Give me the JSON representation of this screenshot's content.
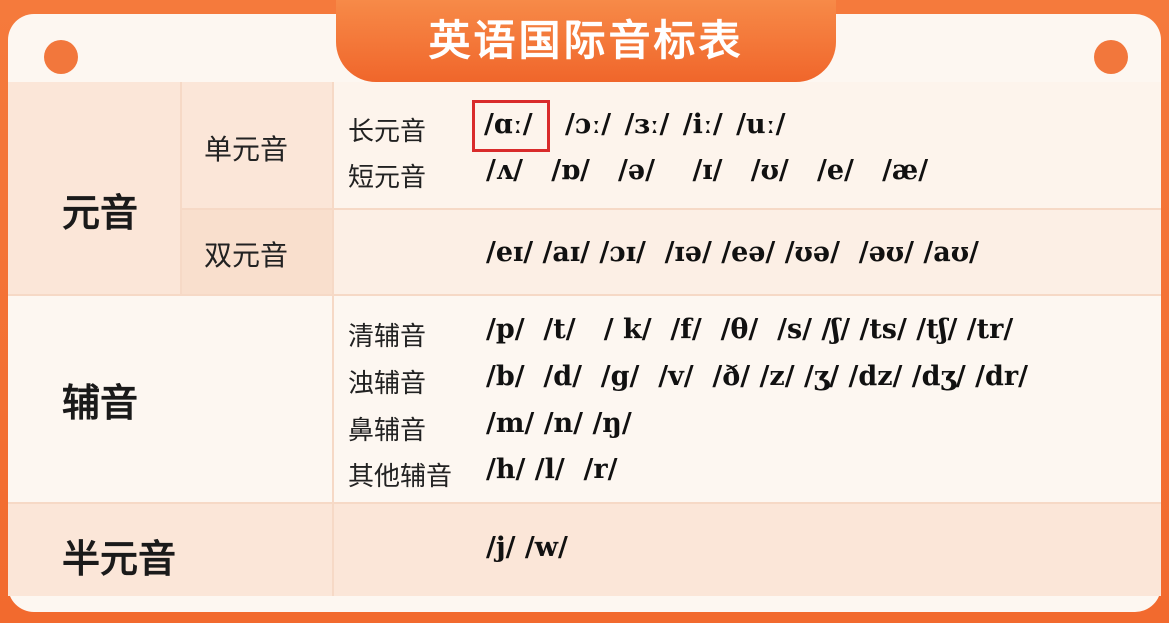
{
  "title": "英语国际音标表",
  "vowels": {
    "category": "元音",
    "monophthongs": {
      "label": "单元音",
      "long": {
        "label": "长元音",
        "highlighted": "/ɑː/",
        "rest": "/ɔː/  /ɜː/  /iː/  /uː/"
      },
      "short": {
        "label": "短元音",
        "symbols": "/ʌ/   /ɒ/   /ə/    /ɪ/   /ʊ/   /e/   /æ/"
      }
    },
    "diphthongs": {
      "label": "双元音",
      "symbols": "/eɪ/ /aɪ/ /ɔɪ/  /ɪə/ /eə/ /ʊə/  /əʊ/ /aʊ/"
    }
  },
  "consonants": {
    "category": "辅音",
    "voiceless": {
      "label": "清辅音",
      "symbols": "/p/  /t/   / k/  /f/  /θ/  /s/ /ʃ/ /ts/ /tʃ/ /tr/"
    },
    "voiced": {
      "label": "浊辅音",
      "symbols": "/b/  /d/  /g/  /v/  /ð/ /z/ /ʒ/ /dz/ /dʒ/ /dr/"
    },
    "nasal": {
      "label": "鼻辅音",
      "symbols": "/m/ /n/ /ŋ/"
    },
    "other": {
      "label": "其他辅音",
      "symbols": "/h/ /l/  /r/"
    }
  },
  "semivowels": {
    "category": "半元音",
    "symbols": "/j/ /w/"
  },
  "colors": {
    "brand_orange": "#f26a2e",
    "highlight_border": "#d92b2b"
  }
}
